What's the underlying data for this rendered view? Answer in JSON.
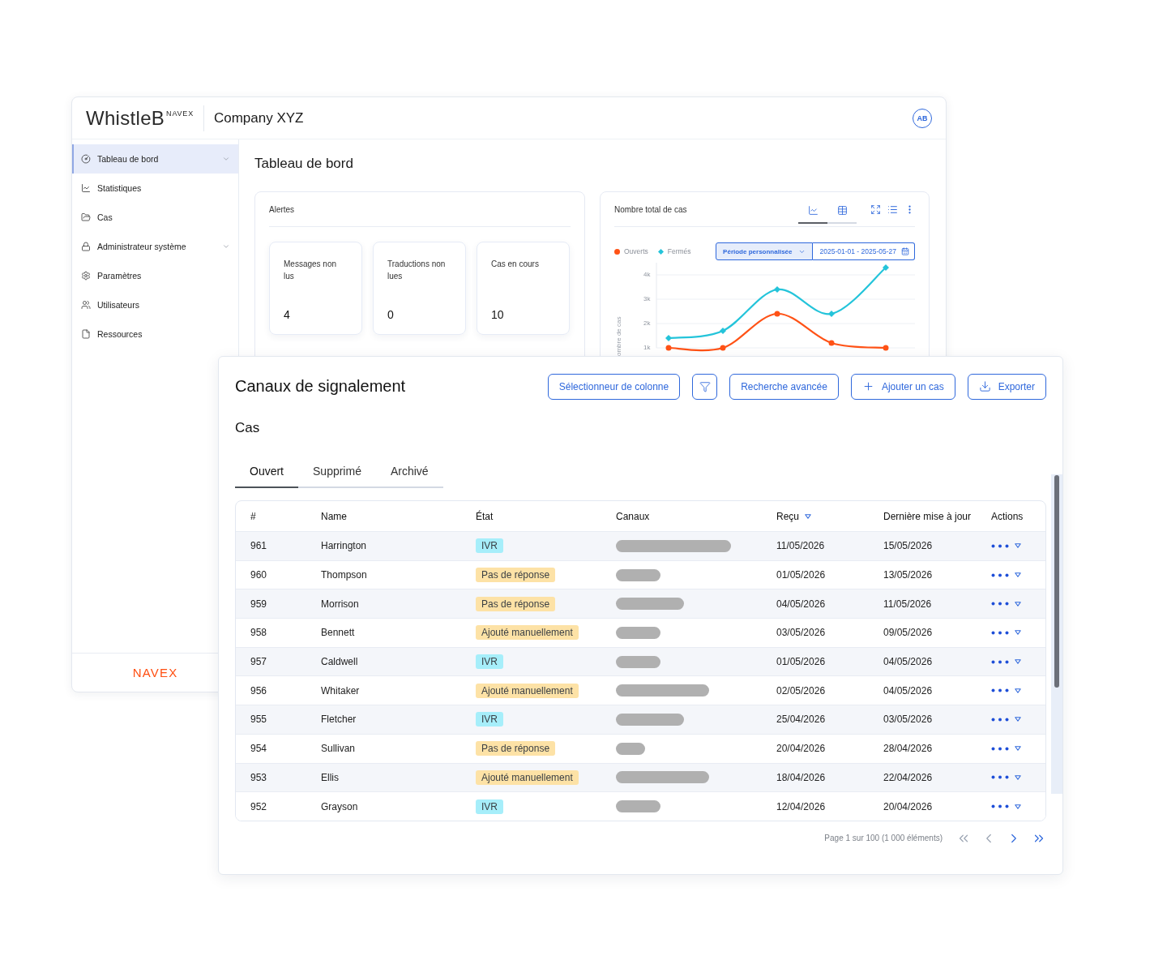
{
  "header": {
    "logo": "WhistleB",
    "logo_superscript": "NAVEX",
    "company": "Company XYZ",
    "avatar": "AB"
  },
  "sidebar": {
    "items": [
      {
        "kind": "dashboard",
        "label": "Tableau de bord",
        "selected": true,
        "expandable": true
      },
      {
        "kind": "statistics",
        "label": "Statistiques",
        "selected": false,
        "expandable": false
      },
      {
        "kind": "cases",
        "label": "Cas",
        "selected": false,
        "expandable": false
      },
      {
        "kind": "admin",
        "label": "Administrateur système",
        "selected": false,
        "expandable": true
      },
      {
        "kind": "settings",
        "label": "Paramètres",
        "selected": false,
        "expandable": false
      },
      {
        "kind": "users",
        "label": "Utilisateurs",
        "selected": false,
        "expandable": false
      },
      {
        "kind": "resources",
        "label": "Ressources",
        "selected": false,
        "expandable": false
      }
    ],
    "footer_logo": "NAVEX"
  },
  "dashboard": {
    "title": "Tableau de bord",
    "alerts": {
      "title": "Alertes",
      "cards": [
        {
          "label": "Messages non lus",
          "value": "4"
        },
        {
          "label": "Traductions non lues",
          "value": "0"
        },
        {
          "label": "Cas en cours",
          "value": "10"
        }
      ]
    },
    "cases_chart": {
      "title": "Nombre total de cas",
      "views": [
        {
          "kind": "line",
          "selected": true
        },
        {
          "kind": "table",
          "selected": false
        }
      ],
      "period": {
        "label": "Période personnalisée",
        "range": "2025-01-01 - 2025-05-27"
      },
      "chart_data": {
        "type": "line",
        "ylabel": "ombre de cas",
        "ylim": [
          1000,
          4500
        ],
        "grid": true,
        "yticks": [
          {
            "value": 1000,
            "label": "1k"
          },
          {
            "value": 2000,
            "label": "2k"
          },
          {
            "value": 3000,
            "label": "3k"
          },
          {
            "value": 4000,
            "label": "4k"
          }
        ],
        "series": [
          {
            "name": "Ouverts",
            "color": "#ff5216",
            "marker": "circle",
            "values": [
              1000,
              1000,
              2400,
              1200,
              1000
            ]
          },
          {
            "name": "Fermés",
            "color": "#24c4da",
            "marker": "diamond",
            "values": [
              1400,
              1700,
              3400,
              2400,
              4300
            ]
          }
        ]
      }
    }
  },
  "panel": {
    "title": "Canaux de signalement",
    "buttons": [
      {
        "kind": "columns",
        "label": "Sélectionneur de colonne"
      },
      {
        "kind": "filter"
      },
      {
        "kind": "search",
        "label": "Recherche avancée"
      },
      {
        "kind": "add",
        "label": "Ajouter un cas"
      },
      {
        "kind": "export",
        "label": "Exporter"
      }
    ],
    "section": "Cas",
    "tabs": [
      {
        "label": "Ouvert",
        "selected": true
      },
      {
        "label": "Supprimé",
        "selected": false
      },
      {
        "label": "Archivé",
        "selected": false
      }
    ],
    "table": {
      "columns": [
        {
          "label": "#",
          "sorted": false
        },
        {
          "label": "Name",
          "sorted": false
        },
        {
          "label": "État",
          "sorted": false
        },
        {
          "label": "Canaux",
          "sorted": false
        },
        {
          "label": "Reçu",
          "sorted": true
        },
        {
          "label": "Dernière mise à jour",
          "sorted": false
        },
        {
          "label": "Actions",
          "sorted": false
        }
      ],
      "rows": [
        {
          "number": "961",
          "name": "Harrington",
          "status": {
            "label": "IVR",
            "color": "#a6eefa"
          },
          "channel": {
            "kind": "xlong"
          },
          "received": "11/05/2026",
          "updated": "15/05/2026"
        },
        {
          "number": "960",
          "name": "Thompson",
          "status": {
            "label": "Pas de réponse",
            "color": "#fde2a6"
          },
          "channel": {
            "kind": "short"
          },
          "received": "01/05/2026",
          "updated": "13/05/2026"
        },
        {
          "number": "959",
          "name": "Morrison",
          "status": {
            "label": "Pas de réponse",
            "color": "#fde2a6"
          },
          "channel": {
            "kind": "medium"
          },
          "received": "04/05/2026",
          "updated": "11/05/2026"
        },
        {
          "number": "958",
          "name": "Bennett",
          "status": {
            "label": "Ajouté manuellement",
            "color": "#fde2a6"
          },
          "channel": {
            "kind": "short"
          },
          "received": "03/05/2026",
          "updated": "09/05/2026"
        },
        {
          "number": "957",
          "name": "Caldwell",
          "status": {
            "label": "IVR",
            "color": "#a6eefa"
          },
          "channel": {
            "kind": "short"
          },
          "received": "01/05/2026",
          "updated": "04/05/2026"
        },
        {
          "number": "956",
          "name": "Whitaker",
          "status": {
            "label": "Ajouté manuellement",
            "color": "#fde2a6"
          },
          "channel": {
            "kind": "long"
          },
          "received": "02/05/2026",
          "updated": "04/05/2026"
        },
        {
          "number": "955",
          "name": "Fletcher",
          "status": {
            "label": "IVR",
            "color": "#a6eefa"
          },
          "channel": {
            "kind": "medium"
          },
          "received": "25/04/2026",
          "updated": "03/05/2026"
        },
        {
          "number": "954",
          "name": "Sullivan",
          "status": {
            "label": "Pas de réponse",
            "color": "#fde2a6"
          },
          "channel": {
            "kind": "tiny"
          },
          "received": "20/04/2026",
          "updated": "28/04/2026"
        },
        {
          "number": "953",
          "name": "Ellis",
          "status": {
            "label": "Ajouté manuellement",
            "color": "#fde2a6"
          },
          "channel": {
            "kind": "long"
          },
          "received": "18/04/2026",
          "updated": "22/04/2026"
        },
        {
          "number": "952",
          "name": "Grayson",
          "status": {
            "label": "IVR",
            "color": "#a6eefa"
          },
          "channel": {
            "kind": "short"
          },
          "received": "12/04/2026",
          "updated": "20/04/2026"
        }
      ]
    },
    "pagination": {
      "summary": "Page 1 sur 100 (1 000 éléments)",
      "buttons": [
        {
          "kind": "first",
          "disabled": true
        },
        {
          "kind": "previous",
          "disabled": true
        },
        {
          "kind": "next",
          "disabled": false
        },
        {
          "kind": "last",
          "disabled": false
        }
      ]
    }
  }
}
